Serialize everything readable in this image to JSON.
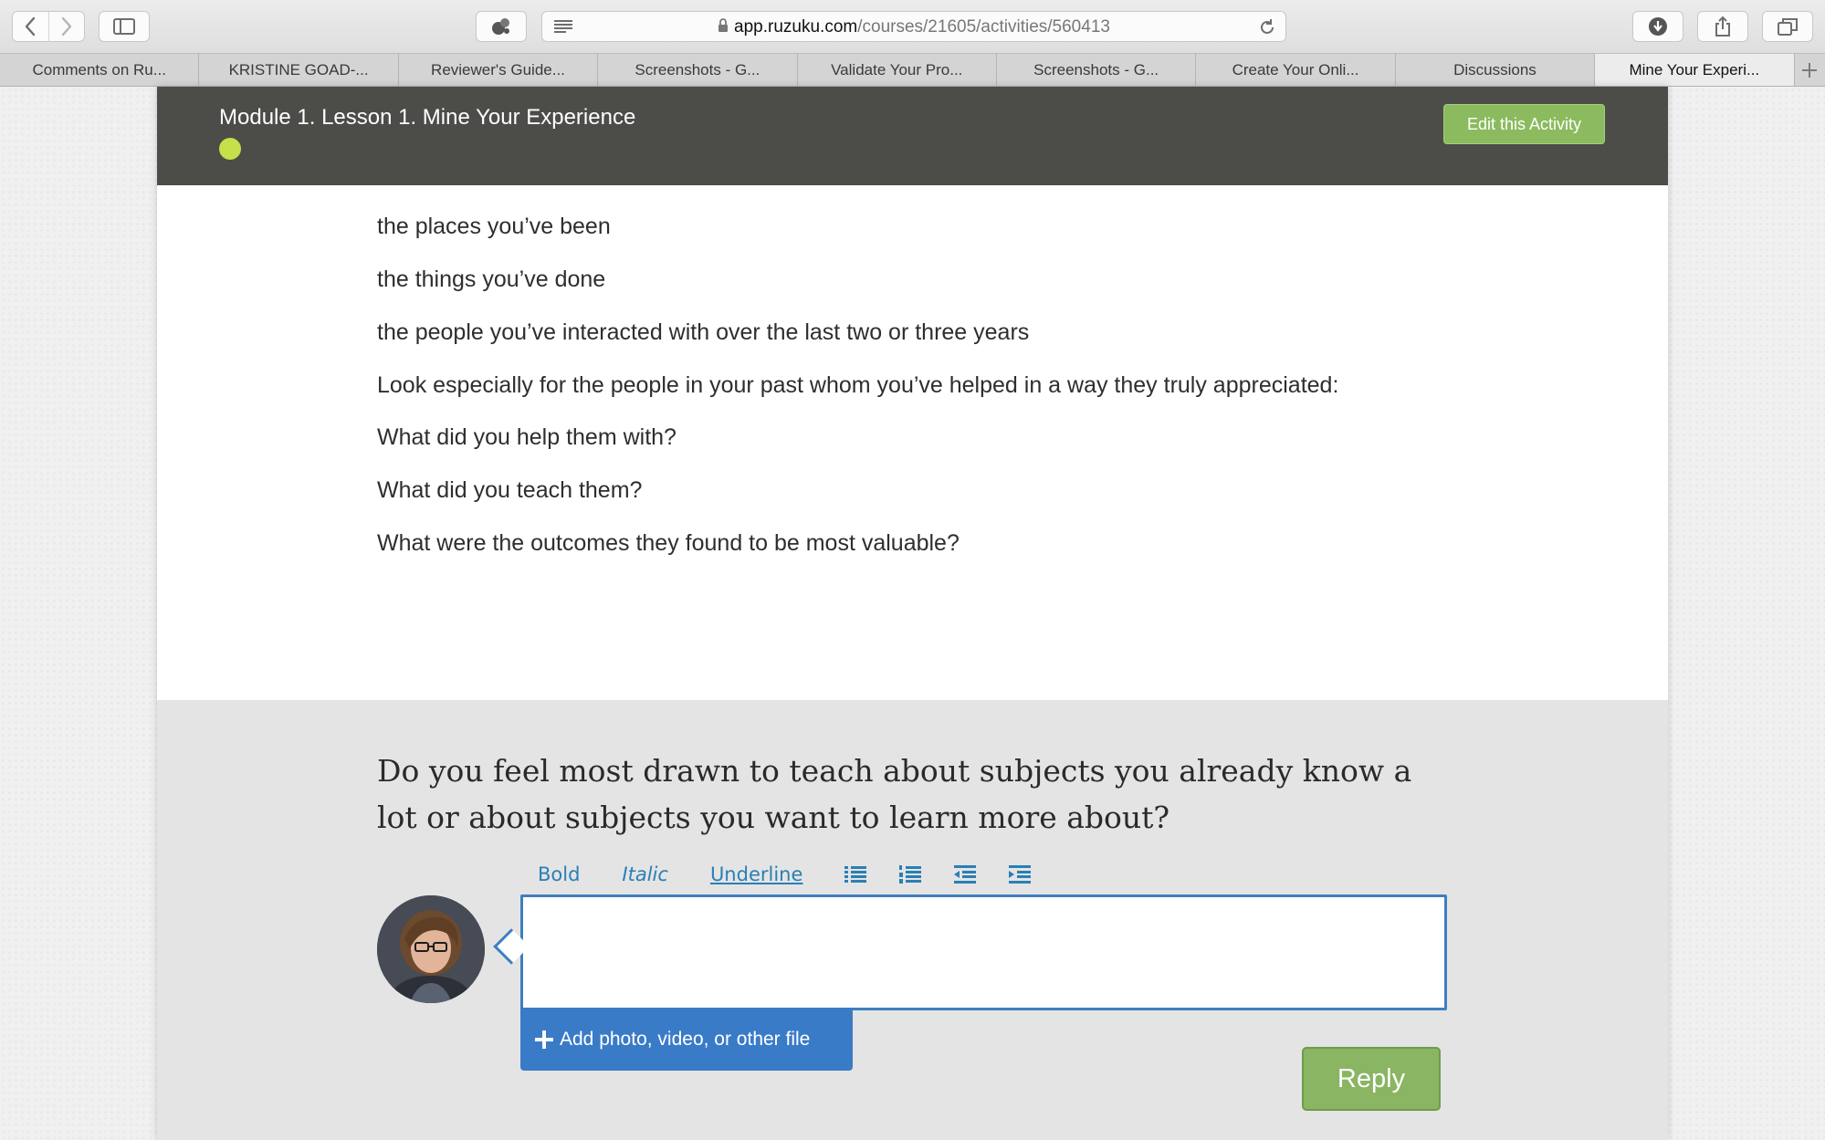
{
  "browser": {
    "url_host": "app.ruzuku.com",
    "url_path": "/courses/21605/activities/560413",
    "tabs": [
      {
        "label": "Comments on Ru..."
      },
      {
        "label": "KRISTINE GOAD-..."
      },
      {
        "label": "Reviewer's Guide..."
      },
      {
        "label": "Screenshots - G..."
      },
      {
        "label": "Validate Your Pro..."
      },
      {
        "label": "Screenshots - G..."
      },
      {
        "label": "Create Your Onli..."
      },
      {
        "label": "Discussions"
      },
      {
        "label": "Mine Your Experi...",
        "active": true
      }
    ]
  },
  "header": {
    "title": "Module 1. Lesson 1. Mine Your Experience",
    "edit_label": "Edit this Activity",
    "status_color": "#c4e04a"
  },
  "content": {
    "paragraphs": [
      "the places you’ve been",
      "the things you’ve done",
      "the people you’ve interacted with over the last two or three years",
      "Look especially for the people in your past whom you’ve helped in a way they truly appreciated:",
      "What did you help them with?",
      "What did you teach them?",
      "What were the outcomes they found to be most valuable?"
    ]
  },
  "discussion": {
    "question": "Do you feel most drawn to teach about subjects you already know a lot or about subjects you want to learn more about?",
    "toolbar": {
      "bold": "Bold",
      "italic": "Italic",
      "underline": "Underline",
      "icons": [
        "bullet-list-icon",
        "numbered-list-icon",
        "outdent-icon",
        "indent-icon"
      ]
    },
    "reply_value": "",
    "add_file_label": "Add photo, video, or other file",
    "reply_label": "Reply"
  },
  "colors": {
    "accent_blue": "#3a7bc8",
    "accent_green": "#8ab563",
    "header_bg": "#4c4c48"
  }
}
